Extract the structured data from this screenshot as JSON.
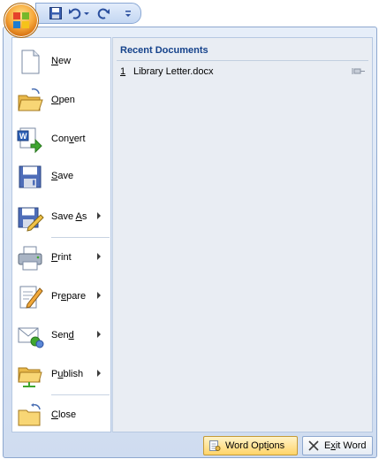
{
  "menu": {
    "items": [
      {
        "label": "New",
        "underline": "N",
        "rest": "ew",
        "icon": "new-document-icon"
      },
      {
        "label": "Open",
        "underline": "O",
        "rest": "pen",
        "icon": "open-folder-icon"
      },
      {
        "label": "Convert",
        "pre": "Con",
        "underline": "v",
        "rest": "ert",
        "icon": "convert-icon"
      },
      {
        "label": "Save",
        "underline": "S",
        "rest": "ave",
        "icon": "save-disk-icon"
      },
      {
        "label": "Save As",
        "pre": "Save ",
        "underline": "A",
        "rest": "s",
        "icon": "save-as-icon"
      },
      {
        "label": "Print",
        "underline": "P",
        "rest": "rint",
        "icon": "printer-icon"
      },
      {
        "label": "Prepare",
        "pre": "Pr",
        "underline": "e",
        "rest": "pare",
        "icon": "prepare-icon"
      },
      {
        "label": "Send",
        "pre": "Sen",
        "underline": "d",
        "rest": "",
        "icon": "send-icon"
      },
      {
        "label": "Publish",
        "pre": "P",
        "underline": "u",
        "rest": "blish",
        "icon": "publish-icon"
      },
      {
        "label": "Close",
        "underline": "C",
        "rest": "lose",
        "icon": "close-folder-icon"
      }
    ]
  },
  "recent": {
    "title": "Recent Documents",
    "documents": [
      {
        "number": "1",
        "name": "Library Letter.docx"
      }
    ]
  },
  "footer": {
    "options_pre": "Word Opt",
    "options_u": "i",
    "options_rest": "ons",
    "exit_pre": "E",
    "exit_u": "x",
    "exit_rest": "it Word"
  },
  "colors": {
    "accent": "#15428b",
    "orb": "#f7a83b"
  }
}
